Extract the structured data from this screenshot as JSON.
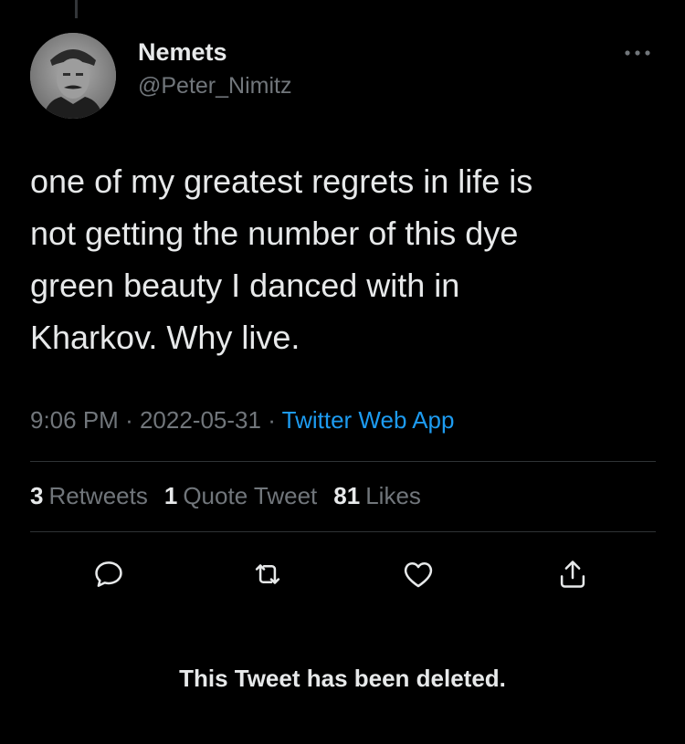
{
  "author": {
    "display_name": "Nemets",
    "handle": "@Peter_Nimitz",
    "avatar_icon": "portrait-photo"
  },
  "tweet": {
    "lines": [
      "one of my greatest regrets in life is",
      "not getting the number of this dye",
      "green beauty I danced with in",
      "Kharkov. Why live."
    ],
    "time": "9:06 PM",
    "separator": "·",
    "date": "2022-05-31",
    "source": "Twitter Web App"
  },
  "stats": {
    "retweets_count": "3",
    "retweets_label": "Retweets",
    "quotes_count": "1",
    "quotes_label": "Quote Tweet",
    "likes_count": "81",
    "likes_label": "Likes"
  },
  "actions": {
    "reply_icon": "speech-bubble-icon",
    "retweet_icon": "retweet-arrows-icon",
    "like_icon": "heart-icon",
    "share_icon": "share-upload-icon"
  },
  "notice": {
    "text": "This Tweet has been deleted."
  },
  "colors": {
    "background": "#000000",
    "text_primary": "#e7e9ea",
    "text_secondary": "#71767b",
    "link_accent": "#1d9bf0",
    "divider": "#2f3336"
  }
}
